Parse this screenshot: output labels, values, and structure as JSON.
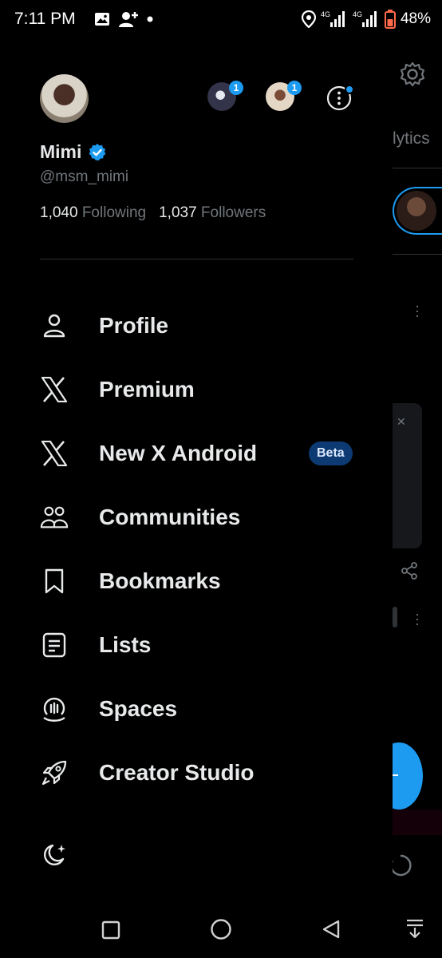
{
  "status_bar": {
    "time": "7:11 PM",
    "left_icons": [
      "image-icon",
      "person-add-icon",
      "dot-icon"
    ],
    "right_icons": [
      "location-icon",
      "signal-4g-icon",
      "signal-4g-icon",
      "battery-icon"
    ],
    "network_label_1": "4G",
    "network_label_2": "4G",
    "battery": "48%"
  },
  "profile": {
    "name": "Mimi",
    "verified": true,
    "handle": "@msm_mimi",
    "following_count": "1,040",
    "following_label": "Following",
    "followers_count": "1,037",
    "followers_label": "Followers",
    "accounts": [
      {
        "badge": "1"
      },
      {
        "badge": "1"
      }
    ]
  },
  "menu": [
    {
      "label": "Profile",
      "icon": "person-icon"
    },
    {
      "label": "Premium",
      "icon": "x-logo-icon"
    },
    {
      "label": "New X Android",
      "icon": "x-logo-icon",
      "badge": "Beta"
    },
    {
      "label": "Communities",
      "icon": "communities-icon"
    },
    {
      "label": "Bookmarks",
      "icon": "bookmark-icon"
    },
    {
      "label": "Lists",
      "icon": "list-icon"
    },
    {
      "label": "Spaces",
      "icon": "spaces-icon"
    },
    {
      "label": "Creator Studio",
      "icon": "rocket-icon"
    }
  ],
  "background_page": {
    "partial_tab_text": "lytics"
  },
  "colors": {
    "accent": "#1d9bf0",
    "background": "#000000",
    "text_primary": "#e7e9ea",
    "text_secondary": "#71767b",
    "beta_badge_bg": "#0e3a73"
  }
}
